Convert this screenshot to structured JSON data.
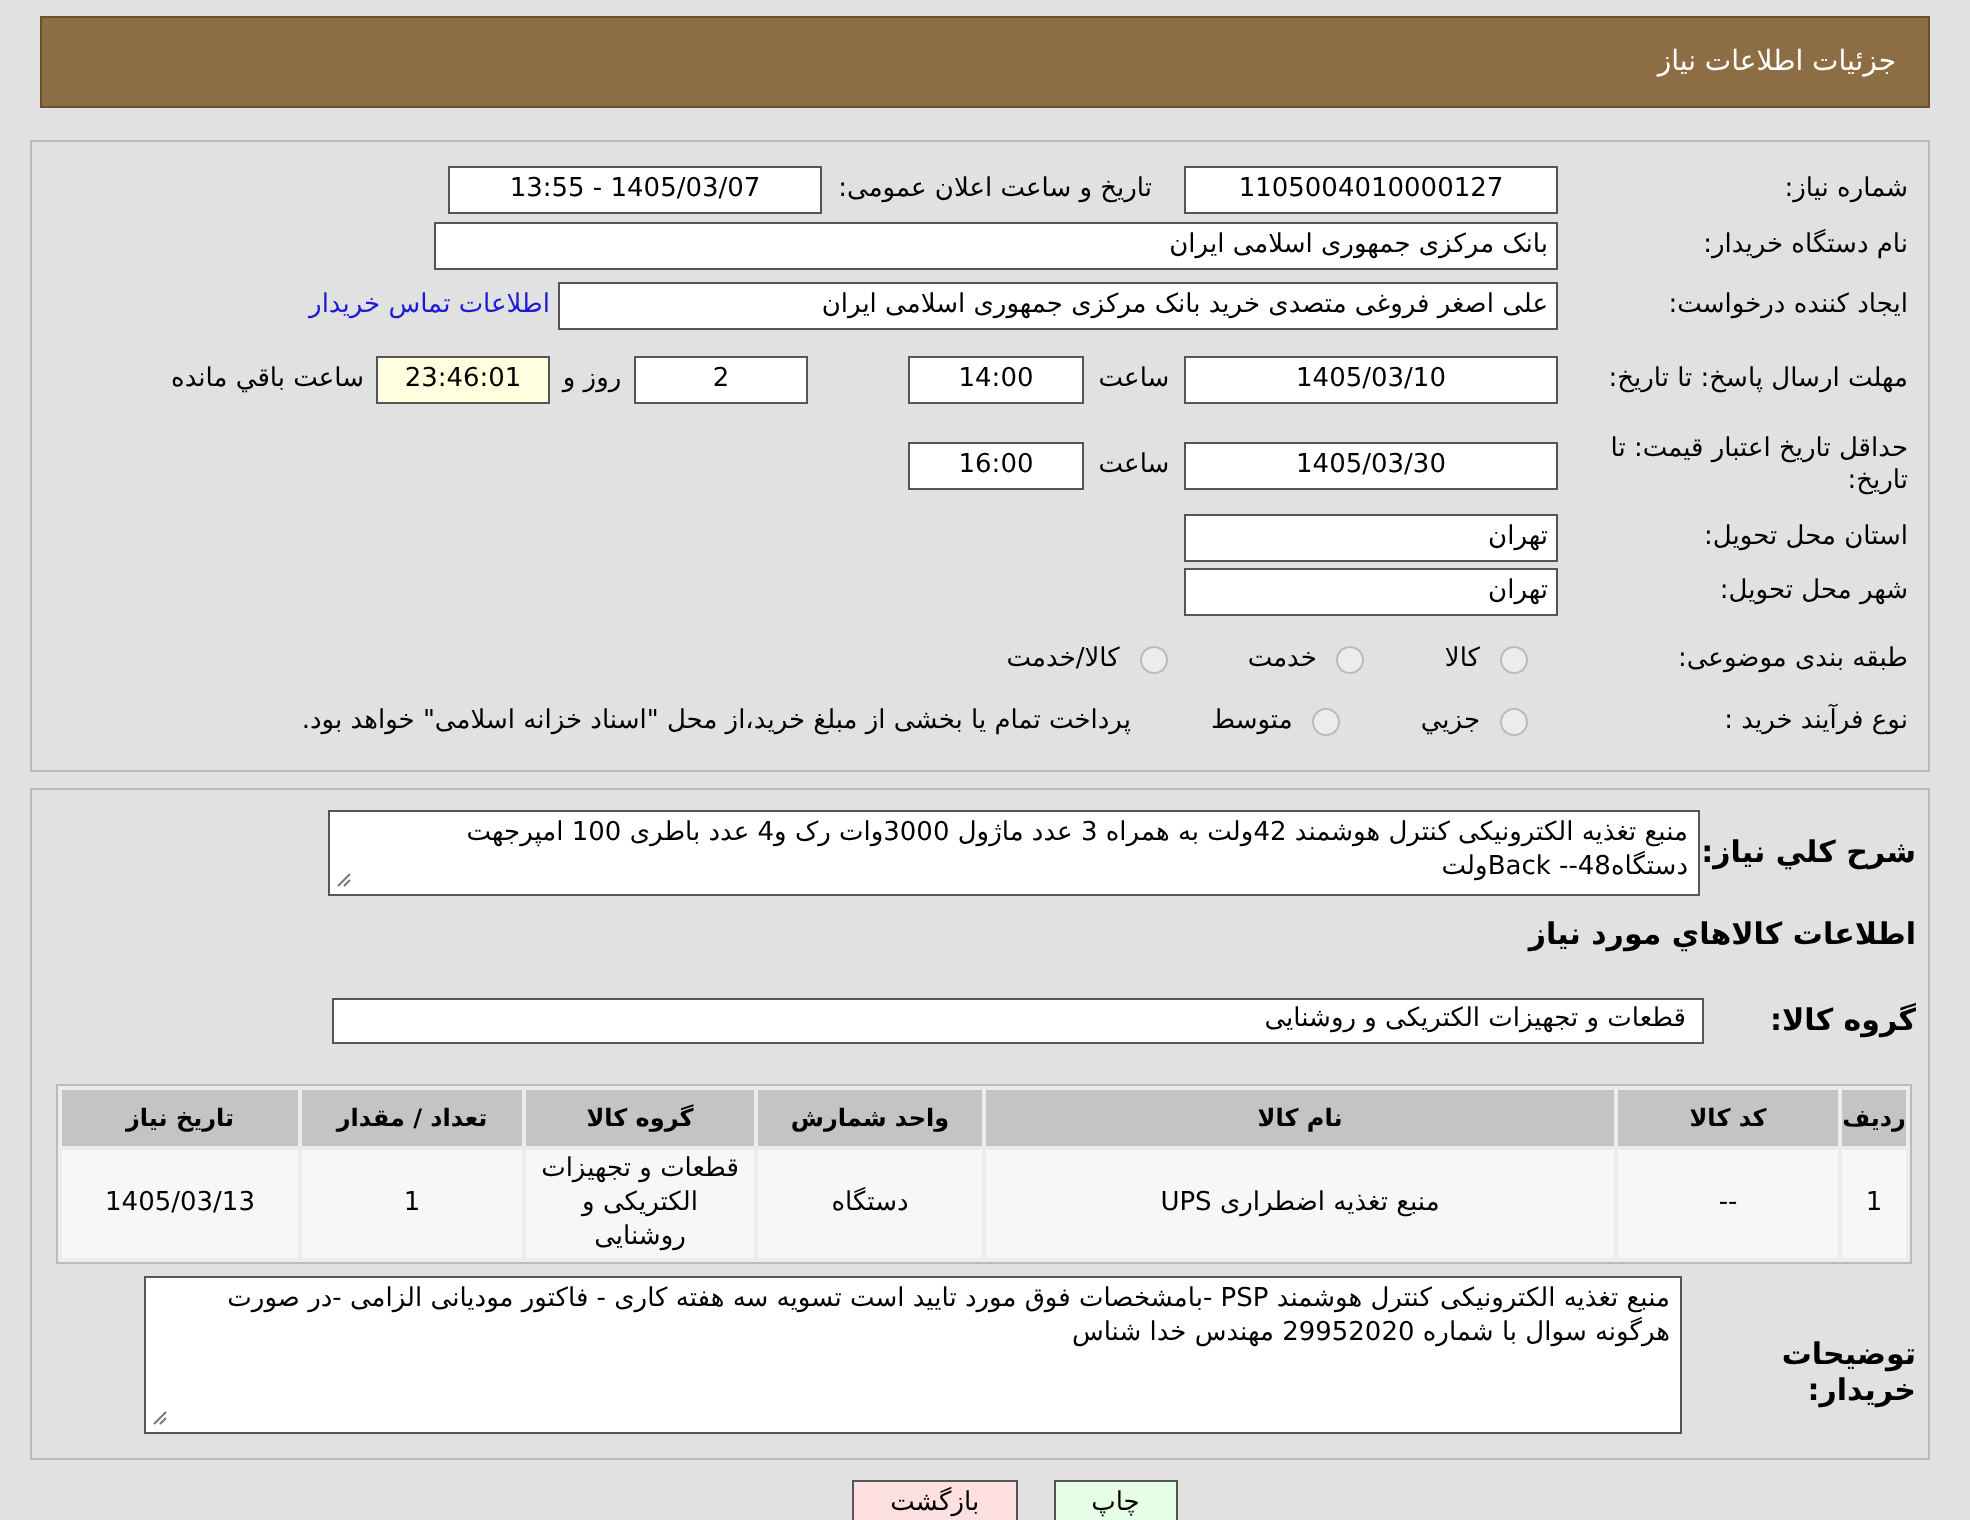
{
  "header": {
    "title": "جزئیات اطلاعات نیاز"
  },
  "fields": {
    "need_number": {
      "label": "شماره نیاز:",
      "value": "1105004010000127"
    },
    "announce": {
      "label": "تاریخ و ساعت اعلان عمومی:",
      "value": "1405/03/07 - 13:55"
    },
    "buyer": {
      "label": "نام دستگاه خریدار:",
      "value": "بانک مرکزی جمهوری اسلامی ایران"
    },
    "creator": {
      "label": "ایجاد کننده درخواست:",
      "value": "علی اصغر فروغی متصدی خرید بانک مرکزی جمهوری اسلامی ایران",
      "link": "اطلاعات تماس خریدار"
    },
    "deadline": {
      "label": "مهلت ارسال پاسخ: تا تاریخ:",
      "date": "1405/03/10",
      "time_label": "ساعت",
      "time": "14:00",
      "days": "2",
      "days_label": "روز و",
      "remaining": "23:46:01",
      "remaining_label": "ساعت باقي مانده"
    },
    "validity": {
      "label": "حداقل تاریخ اعتبار قیمت: تا تاریخ:",
      "date": "1405/03/30",
      "time_label": "ساعت",
      "time": "16:00"
    },
    "province": {
      "label": "استان محل تحویل:",
      "value": "تهران"
    },
    "city": {
      "label": "شهر محل تحویل:",
      "value": "تهران"
    }
  },
  "category": {
    "label": "طبقه بندی موضوعی:",
    "options": [
      {
        "label": "کالا",
        "selected": false
      },
      {
        "label": "خدمت",
        "selected": false
      },
      {
        "label": "کالا/خدمت",
        "selected": false
      }
    ]
  },
  "process": {
    "label": "نوع فرآیند خرید :",
    "options": [
      {
        "label": "جزيي",
        "selected": false
      },
      {
        "label": "متوسط",
        "selected": false
      }
    ],
    "note": "پرداخت تمام یا بخشی از مبلغ خرید،از محل \"اسناد خزانه اسلامی\" خواهد بود."
  },
  "summary": {
    "label": "شرح كلي نياز:",
    "value": "منبع تغذیه الکترونیکی کنترل هوشمند   42ولت     به همراه 3 عدد ماژول 3000وات رک و4 عدد باطری 100 امپرجهت دستگاه48-- Backولت"
  },
  "items_title": "اطلاعات كالاهاي مورد نياز",
  "group": {
    "label": "گروه کالا:",
    "value": "قطعات و تجهیزات الکتریکی و روشنایی"
  },
  "table": {
    "columns": [
      "ردیف",
      "کد کالا",
      "نام کالا",
      "واحد شمارش",
      "گروه کالا",
      "تعداد / مقدار",
      "تاریخ نیاز"
    ],
    "rows": [
      [
        "1",
        "--",
        "منبع تغذیه اضطراری UPS",
        "دستگاه",
        "قطعات و تجهیزات الکتریکی و روشنایی",
        "1",
        "1405/03/13"
      ]
    ]
  },
  "buyer_notes": {
    "label": "توضیحات خریدار:",
    "value": "منبع تغذیه الکترونیکی کنترل هوشمند PSP  -بامشخصات فوق مورد تایید است تسویه سه هفته کاری - فاکتور مودیانی الزامی -در صورت هرگونه سوال با شماره 29952020 مهندس خدا شناس"
  },
  "buttons": [
    {
      "label": "چاپ",
      "kind": "print"
    },
    {
      "label": "بازگشت",
      "kind": "back"
    }
  ]
}
